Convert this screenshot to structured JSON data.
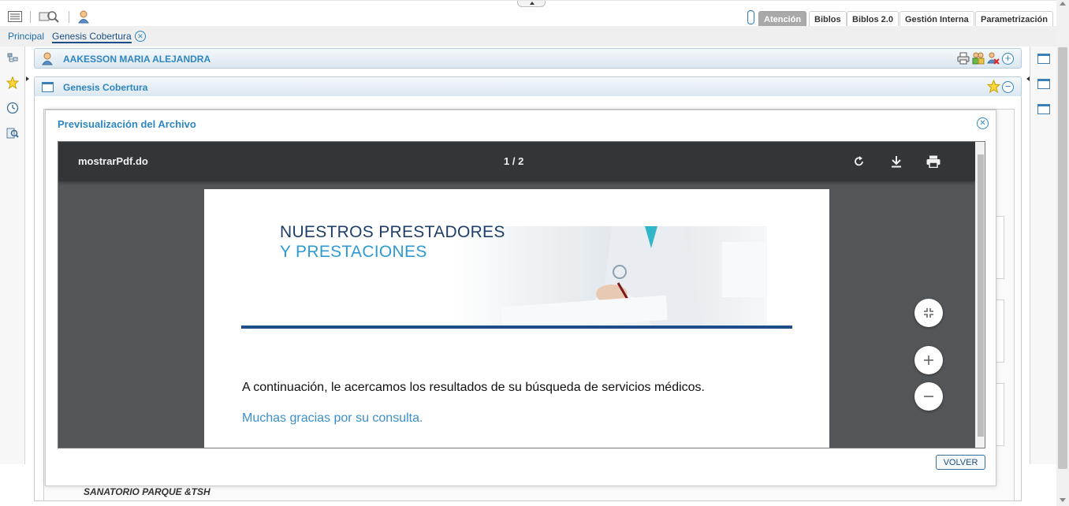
{
  "toolbar": {
    "main_tabs": [
      "Atención",
      "Biblos",
      "Biblos 2.0",
      "Gestión Interna",
      "Parametrización"
    ]
  },
  "breadcrumb": {
    "items": [
      "Principal",
      "Genesis Cobertura"
    ]
  },
  "patient_panel": {
    "name": "AAKESSON MARIA ALEJANDRA"
  },
  "module_panel": {
    "title": "Genesis Cobertura"
  },
  "modal": {
    "title": "Previsualización del Archivo",
    "close_glyph": "✕",
    "volver_label": "VOLVER"
  },
  "pdf_viewer": {
    "file_name": "mostrarPdf.do",
    "page_indicator": "1 / 2",
    "banner_line1": "NUESTROS PRESTADORES",
    "banner_line2": "Y PRESTACIONES",
    "body_text": "A continuación, le acercamos los resultados de su búsqueda de servicios médicos.",
    "thanks_text": "Muchas gracias por su consulta."
  },
  "background": {
    "partial_row_text": "SANATORIO PARQUE &TSH"
  },
  "colors": {
    "accent": "#2e86c1",
    "active_tab": "#a9a9a9",
    "viewer_toolbar": "#323639",
    "viewer_bg": "#525659",
    "banner_blue": "#1d4e86"
  }
}
